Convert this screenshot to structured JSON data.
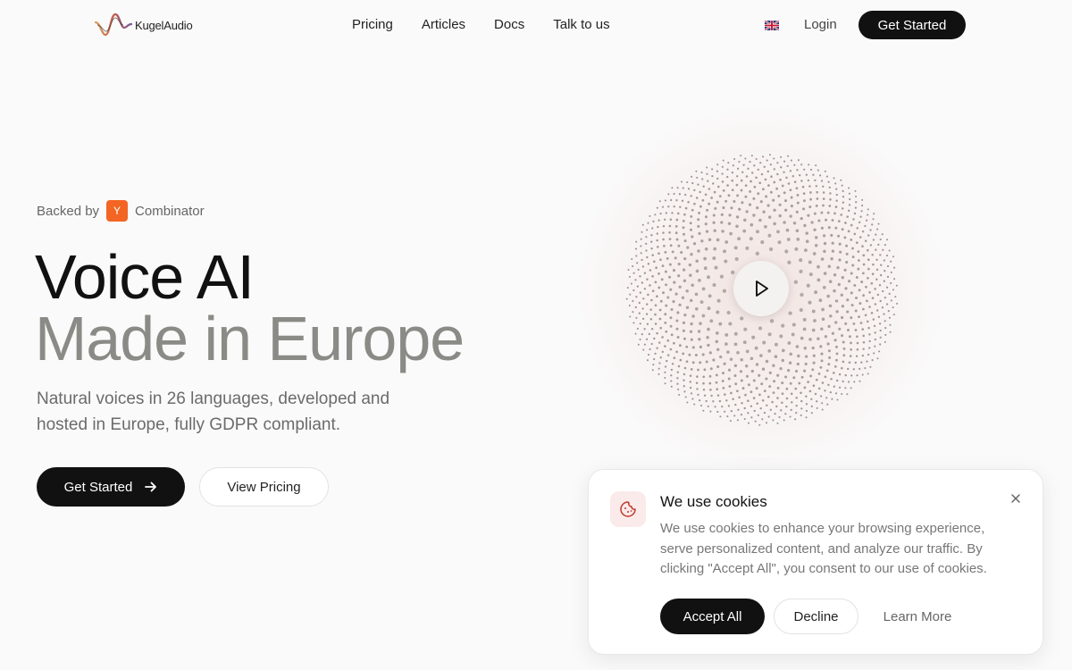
{
  "nav": {
    "brand": "KugelAudio",
    "links": [
      "Pricing",
      "Articles",
      "Docs",
      "Talk to us"
    ],
    "login": "Login",
    "cta": "Get Started"
  },
  "hero": {
    "backed_by": "Backed by",
    "yc_letter": "Y",
    "yc_name": "Combinator",
    "title_line1": "Voice AI",
    "title_line2": "Made in Europe",
    "subtitle": "Natural voices in 26 languages, developed and hosted in Europe, fully GDPR compliant.",
    "primary_cta": "Get Started",
    "secondary_cta": "View Pricing"
  },
  "cookie": {
    "title": "We use cookies",
    "text": "We use cookies to enhance your browsing experience, serve personalized content, and analyze our traffic. By clicking \"Accept All\", you consent to our use of cookies.",
    "accept": "Accept All",
    "decline": "Decline",
    "learn_more": "Learn More"
  },
  "icons": {
    "logo": "waveform-logo-icon",
    "flag": "uk-flag-icon",
    "arrow": "arrow-right-icon",
    "play": "play-icon",
    "cookie": "cookie-icon",
    "close": "close-icon"
  },
  "colors": {
    "accent_dark": "#111111",
    "yc_orange": "#f26522",
    "muted_title": "#8a8a86",
    "orb_dots": "#8f8886"
  }
}
